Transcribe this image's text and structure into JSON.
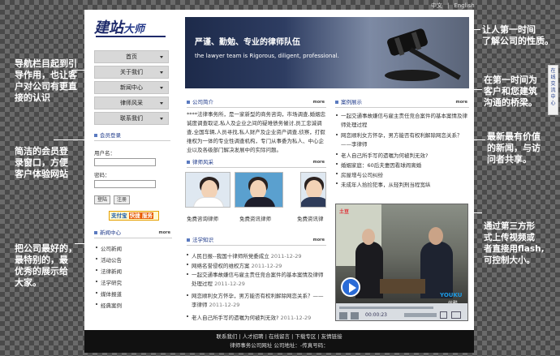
{
  "lang": {
    "zh": "中文",
    "sep": "|",
    "en": "English"
  },
  "logo": {
    "a": "建站",
    "b": "大师"
  },
  "nav": [
    "首页",
    "关于我们",
    "新闻中心",
    "律师风采",
    "联系我们"
  ],
  "annotations": {
    "left1": "导航栏目起到引\n导作用，也让客\n户对公司有更直\n接的认识",
    "left2": "简洁的会员登\n录窗口，方便\n客户体验网站",
    "left3": "把公司最好的，\n最特别的，最\n优秀的展示给\n大家。",
    "right1": "让人第一时间\n了解公司的性质。",
    "right2": "在第一时间为\n客户和您建筑\n沟通的桥梁。",
    "right3": "最新最有价值\n的新闻，与访\n问者共享。",
    "right4": "通过第三方形\n式上传视频或\n者直接用flash,\n可控制大小。"
  },
  "side_tab": "在\n线\n交\n流\n中\n心",
  "login": {
    "title": "会员登录",
    "user": "用户名：",
    "pass": "密码：",
    "btn_login": "登陆",
    "btn_reg": "注册"
  },
  "alipay": {
    "a": "支付宝",
    "b": "快捷 服务"
  },
  "news_center": {
    "title": "新闻中心",
    "more": "more",
    "items": [
      "公司新闻",
      "活动公告",
      "法律新闻",
      "法学研究",
      "媒体报道",
      "经典案例"
    ]
  },
  "banner": {
    "title": "严谨、勤勉、专业的律师队伍",
    "subtitle": "the lawyer team is Rigorous, diligent, professional."
  },
  "intro": {
    "title": "公司简介",
    "more": "more",
    "text": "****法律事务所，是一家新型的商务咨询，市场调查,婚姻忠诚度调查取证,私人及企业之间的疑难债务催讨,员工忠诚调查,全国车辆,人员寻找,私人财产及企业资产调查,侦察，打假维权为一体的专业性调查机构，专门从事委为私人、中心企业以及各级部门解决发展中的实际问题。"
  },
  "lawyers": {
    "title": "律师风采",
    "more": "more",
    "items": [
      "免费咨询律师",
      "免费资讯律师",
      "免费资讯律"
    ]
  },
  "law": {
    "title": "法学知识",
    "more": "more",
    "items": [
      {
        "t": "人民日报--我国十律师所党委成立",
        "d": "2011-12-29"
      },
      {
        "t": "网络名誉侵权的维权方案",
        "d": "2011-12-29"
      },
      {
        "t": "一起交通事故嫌信与雇主责任竞合案件的基本案情及律师处理过程",
        "d": "2011-12-29"
      },
      {
        "t": "网恋顺利女方怀孕，男方能否有权利解除网恋关系？——李律师",
        "d": "2011-12-29"
      },
      {
        "t": "老人自己所手写的遗嘱为何被判无效?",
        "d": "2011-12-29"
      }
    ]
  },
  "cases": {
    "title": "案例展示",
    "more": "more",
    "items": [
      "一起交通事故嫌信与雇主责任竞合案件的基本案情及律师处理过程",
      "网恋顺利女方怀孕，男方能否有权利解除网恋关系？——李律师",
      "老人自己所手写的遗嘱为何被判无效?",
      "婚姻家庭：60后夫妻因看球闹离婚",
      "房屋增与公司纠纷",
      "未成年人拾捡犯事，从轻判刑当程宽纵"
    ]
  },
  "video": {
    "youku": "YOUKU",
    "youku_cn": "优酷",
    "tudou": "土豆",
    "time": "00:00:23"
  },
  "footer": {
    "links": [
      "联系我们",
      "人才招聘",
      "在线留言",
      "下载专区",
      "友情链接"
    ],
    "line2": "律师事务公司网址  公司地址：-传真号码："
  }
}
